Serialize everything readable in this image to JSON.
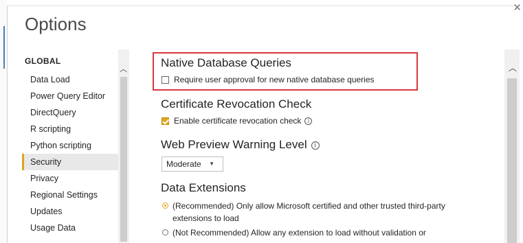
{
  "dialog": {
    "title": "Options",
    "close_icon": "close-icon"
  },
  "nav": {
    "heading": "GLOBAL",
    "items": [
      {
        "label": "Data Load"
      },
      {
        "label": "Power Query Editor"
      },
      {
        "label": "DirectQuery"
      },
      {
        "label": "R scripting"
      },
      {
        "label": "Python scripting"
      },
      {
        "label": "Security",
        "active": true
      },
      {
        "label": "Privacy"
      },
      {
        "label": "Regional Settings"
      },
      {
        "label": "Updates"
      },
      {
        "label": "Usage Data"
      }
    ],
    "scroll_icon": "chevron-up-icon"
  },
  "content": {
    "native_db": {
      "title": "Native Database Queries",
      "checkbox_label": "Require user approval for new native database queries",
      "checked": false
    },
    "cert_revocation": {
      "title": "Certificate Revocation Check",
      "checkbox_label": "Enable certificate revocation check",
      "checked": true
    },
    "web_preview": {
      "title": "Web Preview Warning Level",
      "selected": "Moderate"
    },
    "data_extensions": {
      "title": "Data Extensions",
      "options": [
        {
          "label": "(Recommended) Only allow Microsoft certified and other trusted third-party extensions to load",
          "checked": true
        },
        {
          "label": "(Not Recommended) Allow any extension to load without validation or",
          "checked": false
        }
      ]
    }
  },
  "colors": {
    "accent": "#e1a31b",
    "highlight_border": "#d9363e"
  }
}
